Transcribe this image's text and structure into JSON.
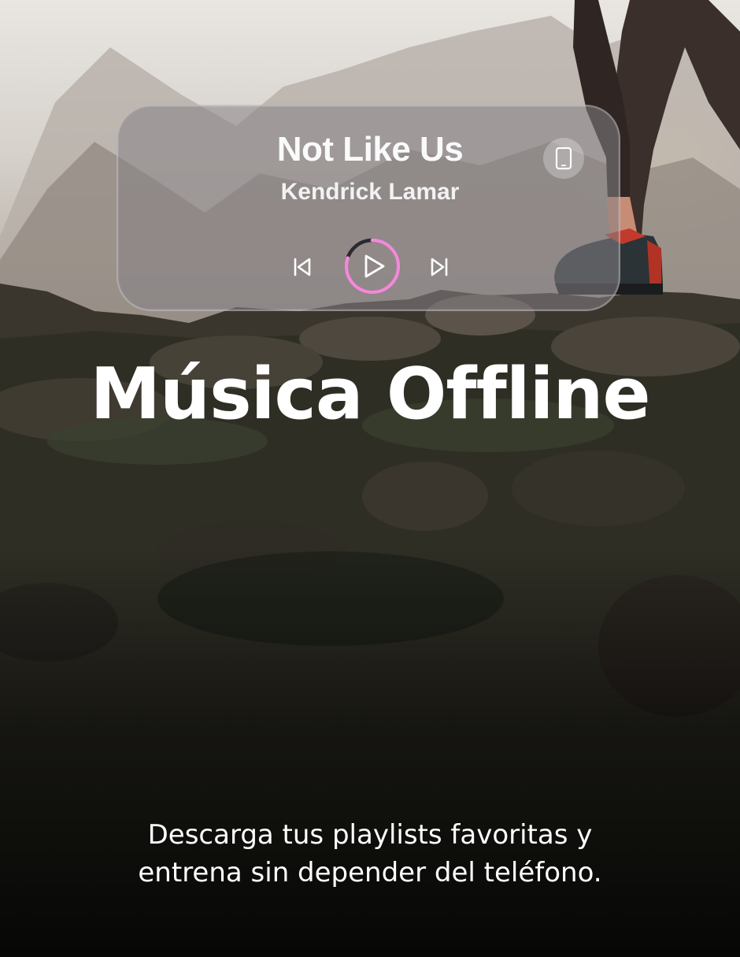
{
  "player": {
    "title": "Not Like Us",
    "artist": "Kendrick Lamar",
    "progress": 0.8,
    "icons": {
      "device": "smartphone-icon",
      "previous": "skip-previous-icon",
      "play": "play-icon",
      "next": "skip-next-icon"
    }
  },
  "headline": "Música Offline",
  "tagline": {
    "line1": "Descarga tus playlists favoritas y",
    "line2": "entrena sin depender del teléfono."
  },
  "colors": {
    "progress_accent": "#f08ad8",
    "progress_track": "#2a2a30",
    "text": "#ffffff"
  }
}
